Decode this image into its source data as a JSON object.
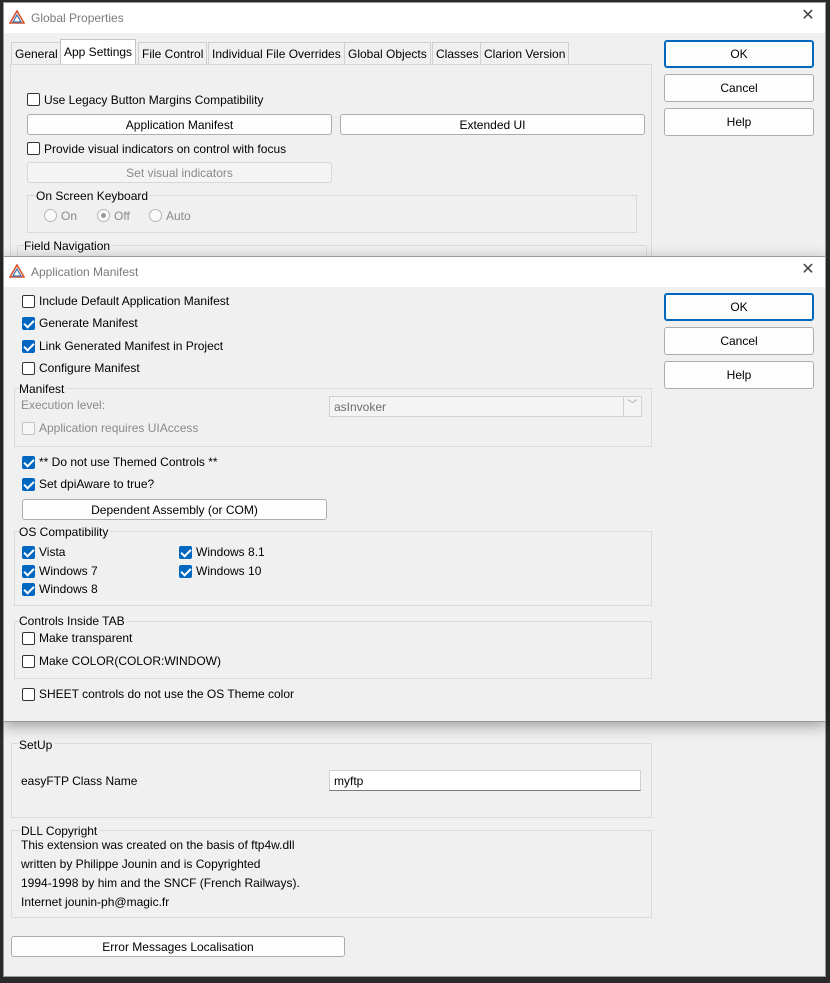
{
  "global_window": {
    "title": "Global Properties",
    "tabs": [
      "General",
      "App Settings",
      "File Control",
      "Individual File Overrides",
      "Global Objects",
      "Classes",
      "Clarion Version"
    ],
    "buttons": {
      "ok": "OK",
      "cancel": "Cancel",
      "help": "Help"
    },
    "legacy_checkbox": "Use Legacy Button Margins Compatibility",
    "app_manifest_button": "Application Manifest",
    "extended_ui_button": "Extended UI",
    "visual_indicators_checkbox": "Provide visual indicators on control with focus",
    "set_visual_indicators_button": "Set visual indicators",
    "osk_group": "On Screen Keyboard",
    "osk_options": [
      "On",
      "Off",
      "Auto"
    ],
    "osk_selected": "Off",
    "field_nav_group": "Field Navigation",
    "setup_group": "SetUp",
    "easyftp_label": "easyFTP Class Name",
    "easyftp_value": "myftp",
    "dll_group": "DLL Copyright",
    "dll_lines": [
      "This extension was created on the basis of ftp4w.dll",
      "written by Philippe Jounin and is Copyrighted",
      "1994-1998 by him and the SNCF (French Railways).",
      "Internet jounin-ph@magic.fr"
    ],
    "error_messages_button": "Error Messages Localisation"
  },
  "manifest_dialog": {
    "title": "Application Manifest",
    "buttons": {
      "ok": "OK",
      "cancel": "Cancel",
      "help": "Help"
    },
    "include_default": "Include Default Application Manifest",
    "generate": "Generate Manifest",
    "link_generated": "Link Generated Manifest in Project",
    "configure": "Configure Manifest",
    "manifest_group": "Manifest",
    "execution_level_label": "Execution level:",
    "execution_level_value": "asInvoker",
    "uiaccess": "Application requires UIAccess",
    "no_themed": "** Do not use Themed Controls **",
    "dpi_aware": "Set dpiAware to true?",
    "dependent_assembly_button": "Dependent Assembly (or COM)",
    "os_group": "OS Compatibility",
    "os_vista": "Vista",
    "os_win7": "Windows 7",
    "os_win8": "Windows 8",
    "os_win81": "Windows 8.1",
    "os_win10": "Windows 10",
    "tab_group": "Controls Inside TAB",
    "make_transparent": "Make transparent",
    "make_color": "Make COLOR(COLOR:WINDOW)",
    "sheet_controls": "SHEET controls do not use the OS Theme color"
  },
  "colors": {
    "accent": "#0067c0",
    "window_bg": "#f0f0f0",
    "title_text": "#7a7a7a"
  },
  "icons": [
    "clarion-logo-icon",
    "close-icon",
    "chevron-down-icon"
  ]
}
